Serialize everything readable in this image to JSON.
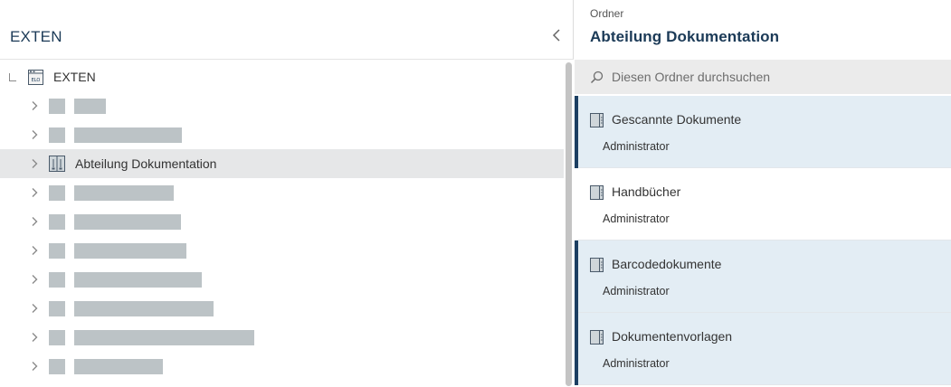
{
  "left_panel": {
    "title": "EXTEN",
    "root": {
      "label": "EXTEN"
    },
    "rows": [
      {
        "type": "redacted",
        "bar_width": 35
      },
      {
        "type": "redacted",
        "bar_width": 119
      },
      {
        "type": "folder",
        "label": "Abteilung Dokumentation",
        "selected": true
      },
      {
        "type": "redacted",
        "bar_width": 110
      },
      {
        "type": "redacted",
        "bar_width": 118
      },
      {
        "type": "redacted",
        "bar_width": 124
      },
      {
        "type": "redacted",
        "bar_width": 141
      },
      {
        "type": "redacted",
        "bar_width": 154
      },
      {
        "type": "redacted",
        "bar_width": 199
      },
      {
        "type": "redacted",
        "bar_width": 98
      }
    ]
  },
  "right_panel": {
    "breadcrumb": "Ordner",
    "title": "Abteilung Dokumentation",
    "search": {
      "placeholder": "Diesen Ordner durchsuchen",
      "value": ""
    },
    "items": [
      {
        "title": "Gescannte Dokumente",
        "owner": "Administrator",
        "highlighted": true
      },
      {
        "title": "Handbücher",
        "owner": "Administrator",
        "highlighted": false
      },
      {
        "title": "Barcodedokumente",
        "owner": "Administrator",
        "highlighted": true
      },
      {
        "title": "Dokumentenvorlagen",
        "owner": "Administrator",
        "highlighted": true
      }
    ]
  },
  "icons": {
    "collapse": "chevron-left-icon",
    "root": "repository-icon",
    "expand": "chevron-right-icon",
    "folder": "folder-icon",
    "search": "search-icon",
    "item": "folder-icon"
  },
  "colors": {
    "title": "#1b3a57",
    "accent": "#1c3f62",
    "selected_row": "#e6e7e8",
    "highlight_item": "#e3edf4",
    "placeholder_block": "#bcc3c6",
    "search_bg": "#ebebeb"
  }
}
